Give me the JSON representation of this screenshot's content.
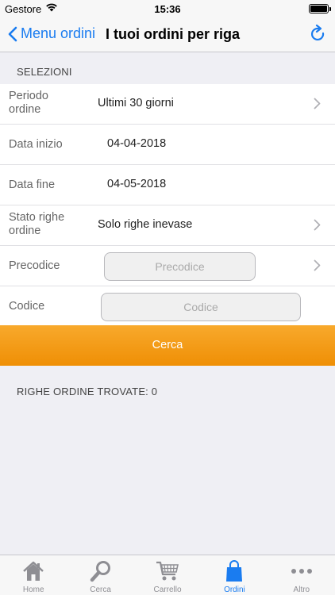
{
  "status": {
    "carrier": "Gestore",
    "time": "15:36"
  },
  "nav": {
    "back_label": "Menu ordini",
    "title": "I tuoi ordini per riga"
  },
  "section_header": "SELEZIONI",
  "form": {
    "periodo_label": "Periodo\nordine",
    "periodo_value": "Ultimi 30 giorni",
    "data_inizio_label": "Data inizio",
    "data_inizio_value": "04-04-2018",
    "data_fine_label": "Data fine",
    "data_fine_value": "04-05-2018",
    "stato_label": "Stato righe\nordine",
    "stato_value": "Solo righe inevase",
    "precodice_label": "Precodice",
    "precodice_placeholder": "Precodice",
    "codice_label": "Codice",
    "codice_placeholder": "Codice"
  },
  "search_button": "Cerca",
  "results_text": "RIGHE ORDINE TROVATE: 0",
  "tabs": [
    {
      "label": "Home",
      "icon": "home-icon"
    },
    {
      "label": "Cerca",
      "icon": "search-icon"
    },
    {
      "label": "Carrello",
      "icon": "cart-icon"
    },
    {
      "label": "Ordini",
      "icon": "bag-icon",
      "active": true
    },
    {
      "label": "Altro",
      "icon": "more-icon"
    }
  ],
  "colors": {
    "accent": "#1a7cf0",
    "orange": "#f39c12",
    "tab_inactive": "#8e8e93"
  }
}
